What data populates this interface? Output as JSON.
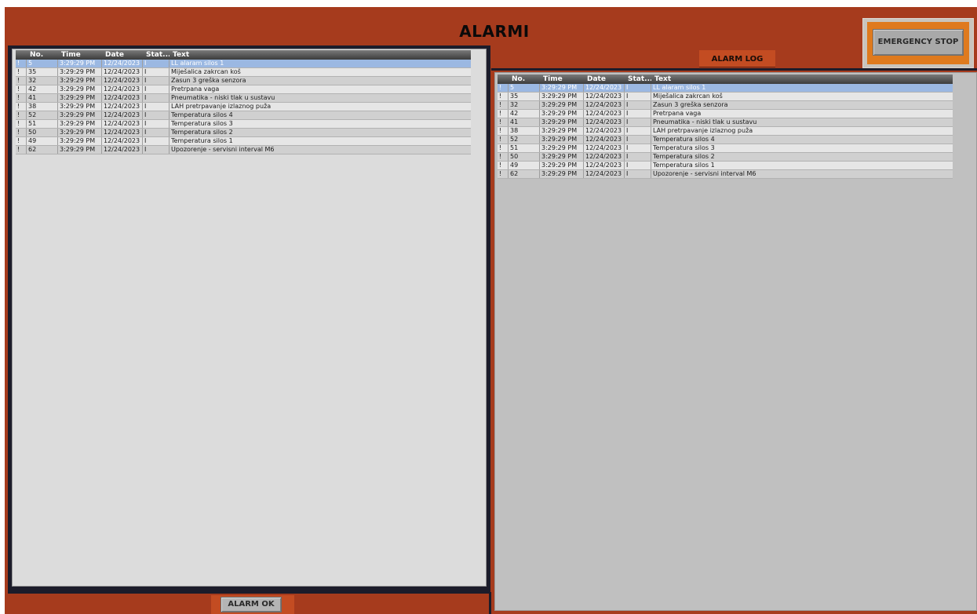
{
  "header": {
    "title": "ALARMI"
  },
  "emergency": {
    "label": "EMERGENCY STOP"
  },
  "alarm_log": {
    "label": "ALARM LOG"
  },
  "alarm_ok": {
    "label": "ALARM OK"
  },
  "columns": [
    "No.",
    "Time",
    "Date",
    "Stat...",
    "Text"
  ],
  "colors": {
    "background": "#a63b1d",
    "selected_row": "#9bb8e2",
    "estop_frame": "#df7a1e"
  },
  "active_alarms": {
    "rows": [
      {
        "flag": "!",
        "no": "5",
        "time": "3:29:29 PM",
        "date": "12/24/2023",
        "status": "I",
        "text": "LL alaram silos 1"
      },
      {
        "flag": "!",
        "no": "35",
        "time": "3:29:29 PM",
        "date": "12/24/2023",
        "status": "I",
        "text": "Miješalica zakrcan koš"
      },
      {
        "flag": "!",
        "no": "32",
        "time": "3:29:29 PM",
        "date": "12/24/2023",
        "status": "I",
        "text": "Zasun 3 greška senzora"
      },
      {
        "flag": "!",
        "no": "42",
        "time": "3:29:29 PM",
        "date": "12/24/2023",
        "status": "I",
        "text": "Pretrpana vaga"
      },
      {
        "flag": "!",
        "no": "41",
        "time": "3:29:29 PM",
        "date": "12/24/2023",
        "status": "I",
        "text": "Pneumatika - niski tlak u sustavu"
      },
      {
        "flag": "!",
        "no": "38",
        "time": "3:29:29 PM",
        "date": "12/24/2023",
        "status": "I",
        "text": "LAH pretrpavanje izlaznog puža"
      },
      {
        "flag": "!",
        "no": "52",
        "time": "3:29:29 PM",
        "date": "12/24/2023",
        "status": "I",
        "text": "Temperatura silos 4"
      },
      {
        "flag": "!",
        "no": "51",
        "time": "3:29:29 PM",
        "date": "12/24/2023",
        "status": "I",
        "text": "Temperatura silos 3"
      },
      {
        "flag": "!",
        "no": "50",
        "time": "3:29:29 PM",
        "date": "12/24/2023",
        "status": "I",
        "text": "Temperatura silos 2"
      },
      {
        "flag": "!",
        "no": "49",
        "time": "3:29:29 PM",
        "date": "12/24/2023",
        "status": "I",
        "text": "Temperatura silos 1"
      },
      {
        "flag": "!",
        "no": "62",
        "time": "3:29:29 PM",
        "date": "12/24/2023",
        "status": "I",
        "text": "Upozorenje - servisni interval M6"
      }
    ]
  },
  "log_alarms": {
    "rows": [
      {
        "flag": "!",
        "no": "5",
        "time": "3:29:29 PM",
        "date": "12/24/2023",
        "status": "I",
        "text": "LL alaram silos 1"
      },
      {
        "flag": "!",
        "no": "35",
        "time": "3:29:29 PM",
        "date": "12/24/2023",
        "status": "I",
        "text": "Miješalica zakrcan koš"
      },
      {
        "flag": "!",
        "no": "32",
        "time": "3:29:29 PM",
        "date": "12/24/2023",
        "status": "I",
        "text": "Zasun 3 greška senzora"
      },
      {
        "flag": "!",
        "no": "42",
        "time": "3:29:29 PM",
        "date": "12/24/2023",
        "status": "I",
        "text": "Pretrpana vaga"
      },
      {
        "flag": "!",
        "no": "41",
        "time": "3:29:29 PM",
        "date": "12/24/2023",
        "status": "I",
        "text": "Pneumatika - niski tlak u sustavu"
      },
      {
        "flag": "!",
        "no": "38",
        "time": "3:29:29 PM",
        "date": "12/24/2023",
        "status": "I",
        "text": "LAH pretrpavanje izlaznog puža"
      },
      {
        "flag": "!",
        "no": "52",
        "time": "3:29:29 PM",
        "date": "12/24/2023",
        "status": "I",
        "text": "Temperatura silos 4"
      },
      {
        "flag": "!",
        "no": "51",
        "time": "3:29:29 PM",
        "date": "12/24/2023",
        "status": "I",
        "text": "Temperatura silos 3"
      },
      {
        "flag": "!",
        "no": "50",
        "time": "3:29:29 PM",
        "date": "12/24/2023",
        "status": "I",
        "text": "Temperatura silos 2"
      },
      {
        "flag": "!",
        "no": "49",
        "time": "3:29:29 PM",
        "date": "12/24/2023",
        "status": "I",
        "text": "Temperatura silos 1"
      },
      {
        "flag": "!",
        "no": "62",
        "time": "3:29:29 PM",
        "date": "12/24/2023",
        "status": "I",
        "text": "Upozorenje - servisni interval M6"
      }
    ]
  }
}
